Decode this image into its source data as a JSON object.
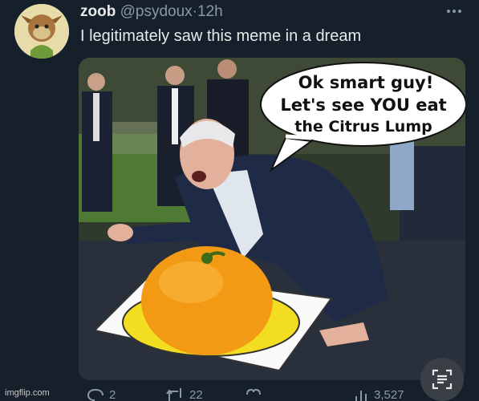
{
  "tweet": {
    "display_name": "zoob",
    "handle": "@psydoux",
    "separator": "·",
    "time": "12h",
    "text": "I legitimately saw this meme in a dream"
  },
  "meme": {
    "bubble_lines": [
      "Ok smart guy!",
      "Let's see YOU eat",
      "the Citrus Lump"
    ]
  },
  "actions": {
    "replies": "2",
    "retweets": "22",
    "views": "3,527"
  },
  "icons": {
    "more": "more-icon",
    "reply": "reply-icon",
    "retweet": "retweet-icon",
    "like": "like-icon",
    "views": "views-icon",
    "scan": "scan-text-icon"
  },
  "colors": {
    "background": "#15202b",
    "text": "#e7e9ea",
    "muted": "#8b98a5"
  },
  "watermark": "imgflip.com"
}
